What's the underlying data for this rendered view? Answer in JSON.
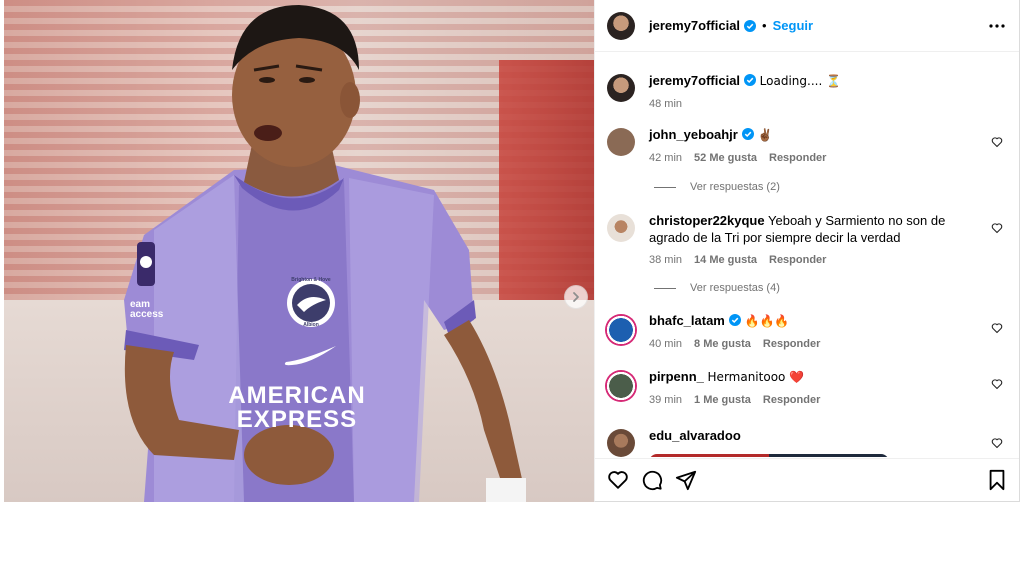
{
  "post": {
    "author": "jeremy7official",
    "separator": "•",
    "follow_label": "Seguir"
  },
  "caption": {
    "username": "jeremy7official",
    "text": "Loading.... ⏳",
    "time": "48 min"
  },
  "comments": [
    {
      "username": "john_yeboahjr",
      "verified": true,
      "text": "✌🏾",
      "time": "42 min",
      "likes": "52 Me gusta",
      "reply": "Responder",
      "avatar_color": "#8a6a55"
    },
    {
      "username": "christoper22kyque",
      "verified": false,
      "text": "Yeboah y Sarmiento no son de agrado de la Tri por siempre decir la verdad",
      "time": "38 min",
      "likes": "14 Me gusta",
      "reply": "Responder",
      "avatar_color": "#c9b8a6"
    },
    {
      "username": "bhafc_latam",
      "verified": true,
      "text": "🔥🔥🔥",
      "time": "40 min",
      "likes": "8 Me gusta",
      "reply": "Responder",
      "avatar_color": "#1d5fb0"
    },
    {
      "username": "pirpenn_",
      "verified": false,
      "text": "Hermanitooo ❤️",
      "time": "39 min",
      "likes": "1 Me gusta",
      "reply": "Responder",
      "avatar_color": "#4b5d4a"
    },
    {
      "username": "edu_alvaradoo",
      "verified": false,
      "text": "",
      "time": "",
      "likes": "",
      "reply": "",
      "avatar_color": "#7b5a44"
    }
  ],
  "view_replies": [
    "Ver respuestas (2)",
    "Ver respuestas (4)"
  ],
  "photo": {
    "badge_lines": [
      "Brighton & Hove",
      "Albion"
    ],
    "sponsor_line1": "AMERICAN",
    "sponsor_line2": "EXPRESS",
    "sleeve_text": "eam\naccess"
  },
  "colors": {
    "accent": "#0095f6",
    "verified": "#0095f6",
    "muted": "#737373",
    "kit_purple": "#9d8bd6"
  },
  "icons": [
    "chevron-right-icon",
    "more-horizontal-icon",
    "verified-badge-icon",
    "heart-icon",
    "comment-icon",
    "share-icon",
    "bookmark-icon"
  ]
}
